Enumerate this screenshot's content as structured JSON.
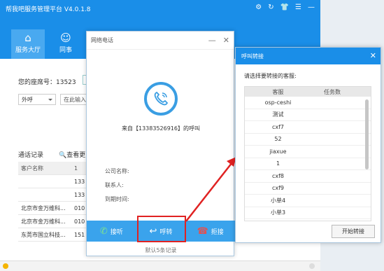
{
  "app": {
    "title": "帮我吧服务管理平台 V4.0.1.8",
    "nav": [
      {
        "label": "服务大厅",
        "icon": "home-icon",
        "active": true
      },
      {
        "label": "同事",
        "icon": "people-icon",
        "active": false
      }
    ],
    "seat_label": "您的座席号：13523",
    "call_type": "外呼",
    "input_placeholder": "在此输入",
    "history_label": "通话记录",
    "more_label": "查看更多",
    "table": {
      "headers": [
        "客户名称",
        "1"
      ],
      "rows": [
        [
          "",
          "133"
        ],
        [
          "",
          "133"
        ],
        [
          "北京市金万维科...",
          "010"
        ],
        [
          "北京市金万维科...",
          "010"
        ],
        [
          "东莞市国立科技...",
          "151"
        ]
      ]
    }
  },
  "call_dialog": {
    "title": "网络电话",
    "caller_text": "来自【13383526916】的呼叫",
    "fields": [
      "公司名称:",
      "联系人:",
      "到期时间:"
    ],
    "answer": "接听",
    "transfer": "呼转",
    "reject": "拒接",
    "records_note": "默认5条记录"
  },
  "transfer_dialog": {
    "title": "呼叫转接",
    "prompt": "请选择要转接的客服:",
    "col_service": "客服",
    "col_tasks": "任务数",
    "agents": [
      "osp-ceshi",
      "测试",
      "cxf7",
      "52",
      "jiaxue",
      "1",
      "cxf8",
      "cxf9",
      "小单4",
      "小单3"
    ],
    "start_button": "开始转接"
  },
  "colors": {
    "primary": "#1a8ee8",
    "action_bar": "#3aa3ec",
    "highlight": "#e02222"
  }
}
